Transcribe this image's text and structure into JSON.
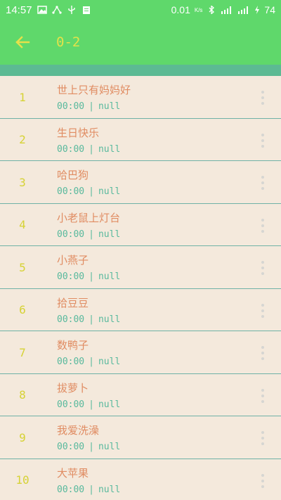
{
  "status_bar": {
    "time": "14:57",
    "speed": "0.01",
    "speed_unit": "K/s",
    "battery": "74"
  },
  "app_bar": {
    "back_icon": "arrow-left-icon",
    "title": "0-2"
  },
  "colors": {
    "primary": "#5fd86b",
    "band": "#5cba93",
    "background": "#f4e9dc",
    "index": "#d6d235",
    "title": "#e08c62",
    "subtitle": "#58b99d"
  },
  "list": {
    "items": [
      {
        "index": "1",
        "title": "世上只有妈妈好",
        "duration": "00:00",
        "separator": "|",
        "artist": "null"
      },
      {
        "index": "2",
        "title": "生日快乐",
        "duration": "00:00",
        "separator": "|",
        "artist": "null"
      },
      {
        "index": "3",
        "title": "哈巴狗",
        "duration": "00:00",
        "separator": "|",
        "artist": "null"
      },
      {
        "index": "4",
        "title": "小老鼠上灯台",
        "duration": "00:00",
        "separator": "|",
        "artist": "null"
      },
      {
        "index": "5",
        "title": "小燕子",
        "duration": "00:00",
        "separator": "|",
        "artist": "null"
      },
      {
        "index": "6",
        "title": "拾豆豆",
        "duration": "00:00",
        "separator": "|",
        "artist": "null"
      },
      {
        "index": "7",
        "title": "数鸭子",
        "duration": "00:00",
        "separator": "|",
        "artist": "null"
      },
      {
        "index": "8",
        "title": "拔萝卜",
        "duration": "00:00",
        "separator": "|",
        "artist": "null"
      },
      {
        "index": "9",
        "title": "我爱洗澡",
        "duration": "00:00",
        "separator": "|",
        "artist": "null"
      },
      {
        "index": "10",
        "title": "大苹果",
        "duration": "00:00",
        "separator": "|",
        "artist": "null"
      }
    ]
  }
}
